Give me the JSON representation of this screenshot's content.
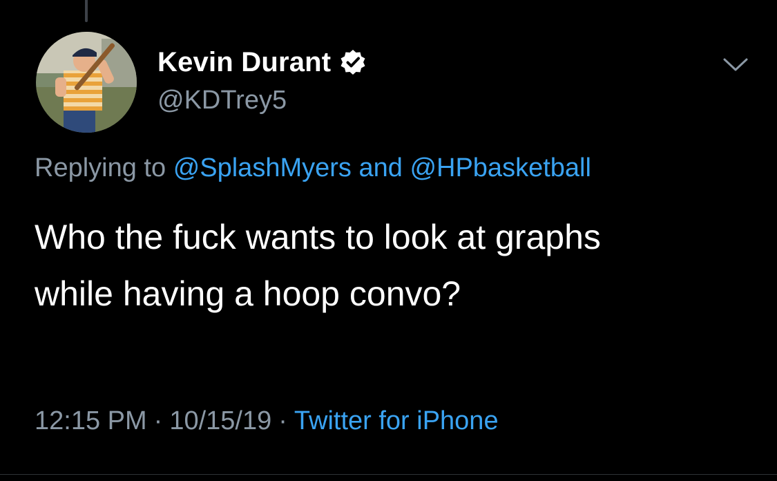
{
  "tweet": {
    "author": {
      "display_name": "Kevin Durant",
      "handle": "@KDTrey5",
      "verified": true,
      "avatar_icon": "avatar-photo"
    },
    "reply": {
      "prefix": "Replying to",
      "mention_1": "@SplashMyers",
      "connector": "and",
      "mention_2": "@HPbasketball"
    },
    "text_line_1": "Who the fuck wants to look at graphs",
    "text_line_2": "while having a hoop convo?",
    "time": "12:15 PM",
    "date": "10/15/19",
    "separator": "·",
    "source": "Twitter for iPhone",
    "menu_icon": "chevron-down-icon"
  },
  "colors": {
    "background": "#000000",
    "primary_text": "#ffffff",
    "secondary_text": "#8b98a5",
    "link": "#3aa3f2",
    "divider": "#2f3336"
  }
}
